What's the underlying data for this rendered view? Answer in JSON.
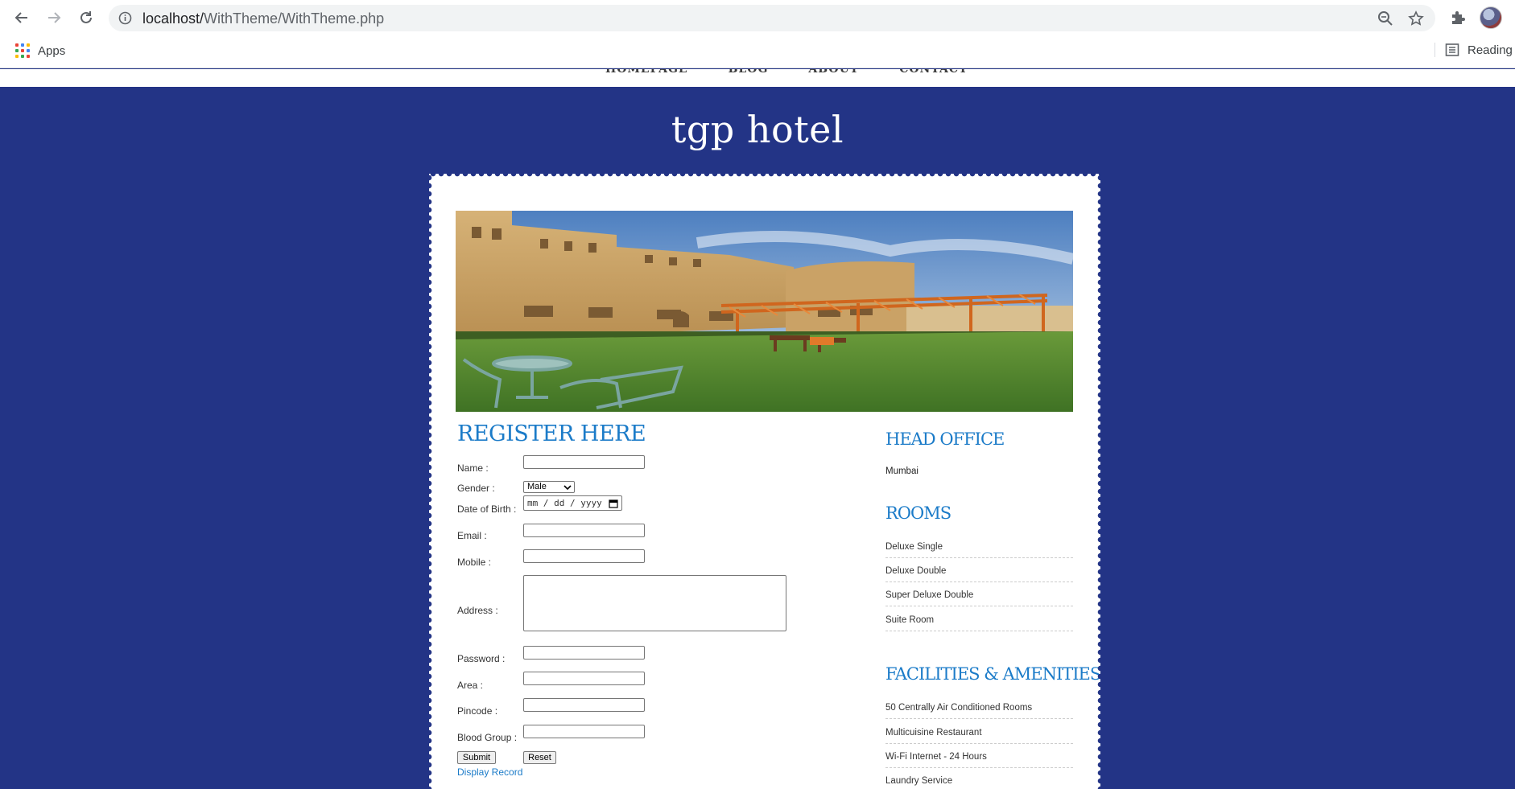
{
  "browser": {
    "url_scheme": "localhost/",
    "url_path": "WithTheme/WithTheme.php",
    "bookmarks_apps_label": "Apps",
    "reading_list_label": "Reading"
  },
  "top_nav": [
    "HOMEPAGE",
    "BLOG",
    "ABOUT",
    "CONTACT"
  ],
  "site": {
    "title": "tgp hotel"
  },
  "form": {
    "title": "REGISTER HERE",
    "name_label": "Name :",
    "gender_label": "Gender :",
    "gender_selected": "Male",
    "dob_label": "Date of Birth :",
    "dob_placeholder": "mm / dd / yyyy",
    "email_label": "Email :",
    "mobile_label": "Mobile :",
    "address_label": "Address :",
    "password_label": "Password :",
    "area_label": "Area :",
    "pincode_label": "Pincode :",
    "blood_group_label": "Blood Group :",
    "submit_label": "Submit",
    "reset_label": "Reset",
    "display_record_link": "Display Record"
  },
  "sidebar": {
    "head_office_title": "HEAD OFFICE",
    "head_office_city": "Mumbai",
    "rooms_title": "ROOMS",
    "rooms": [
      "Deluxe Single",
      "Deluxe Double",
      "Super Deluxe Double",
      "Suite Room"
    ],
    "facilities_title": "FACILITIES & AMENITIES",
    "facilities": [
      "50 Centrally Air Conditioned Rooms",
      "Multicuisine Restaurant",
      "Wi-Fi Internet - 24 Hours",
      "Laundry Service"
    ]
  },
  "colors": {
    "page_background": "#233486",
    "accent_blue": "#1b7bc8",
    "card_background": "#ffffff"
  }
}
